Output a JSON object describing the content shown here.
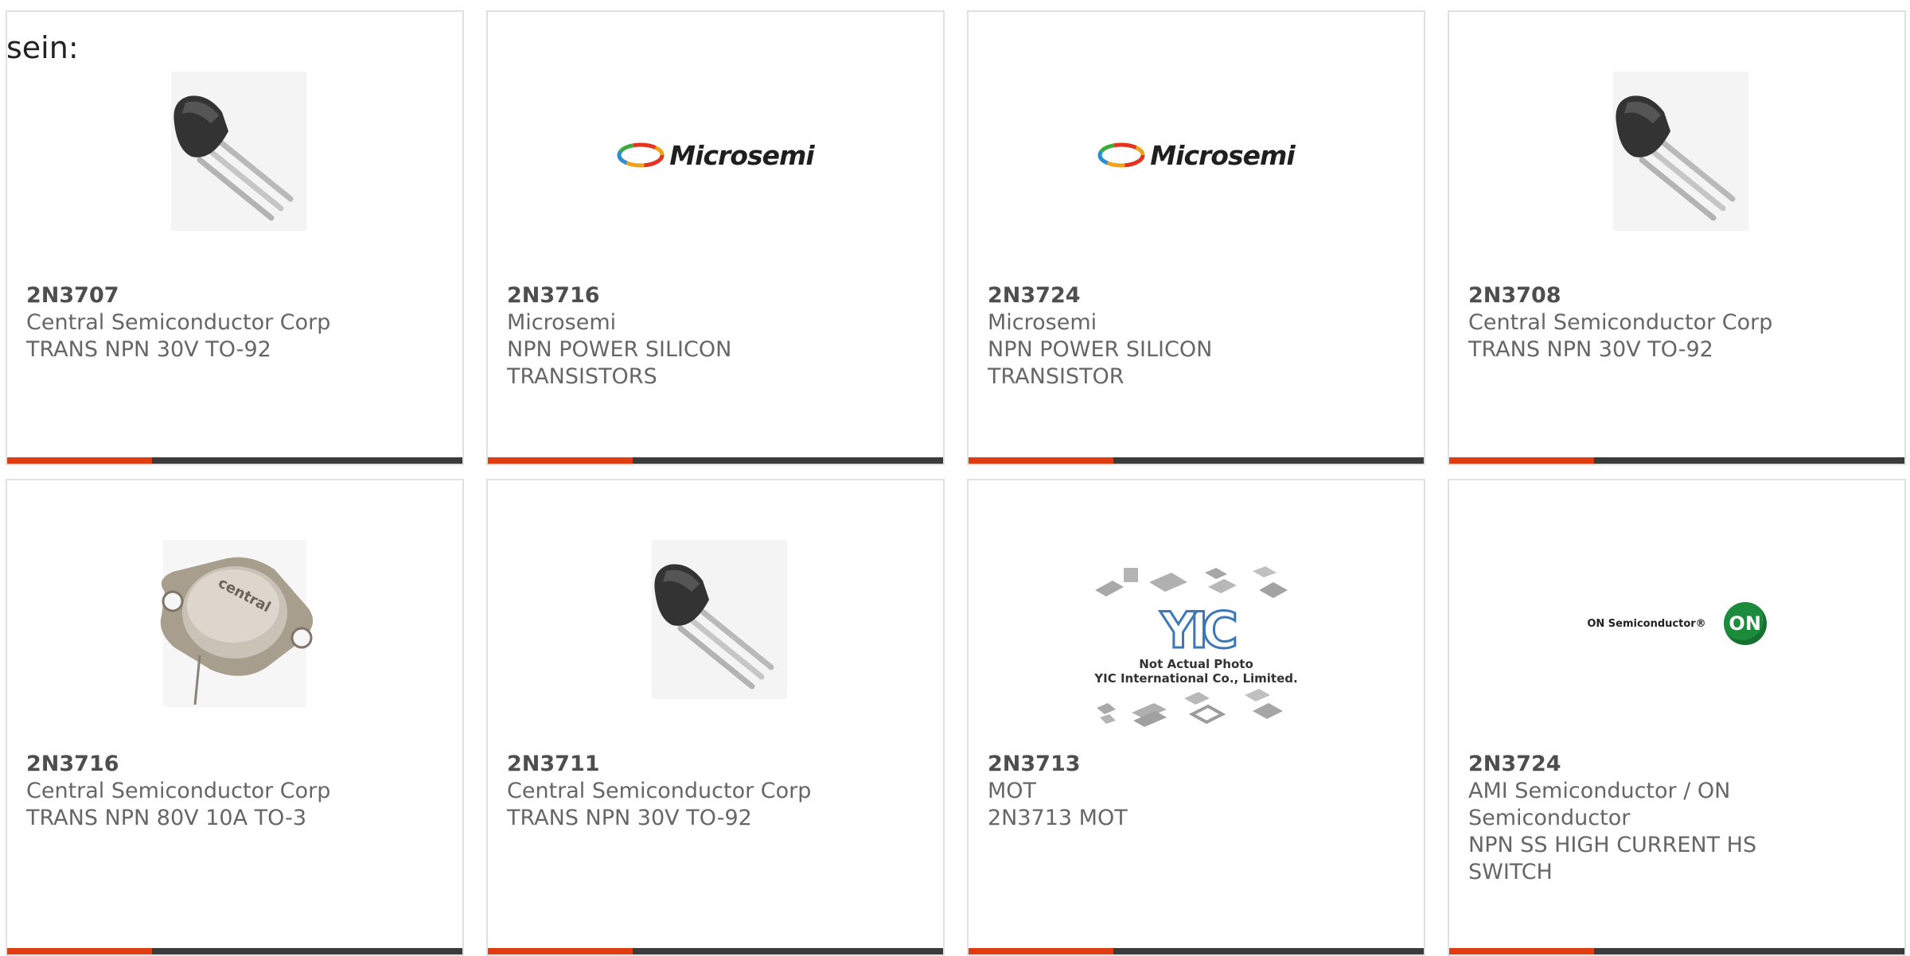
{
  "intro_text": "sein:",
  "colors": {
    "accent": "#e03c12",
    "bar": "#3b3b3b",
    "border": "#e1e1e1"
  },
  "products": [
    {
      "part": "2N3707",
      "manufacturer": "Central Semiconductor Corp",
      "desc_lines": [
        "TRANS NPN 30V TO-92"
      ],
      "image": "to92-transistor"
    },
    {
      "part": "2N3716",
      "manufacturer": "Microsemi",
      "desc_lines": [
        "NPN POWER SILICON",
        "TRANSISTORS"
      ],
      "image": "microsemi-logo",
      "logo_text": "Microsemi"
    },
    {
      "part": "2N3724",
      "manufacturer": "Microsemi",
      "desc_lines": [
        "NPN POWER SILICON",
        "TRANSISTOR"
      ],
      "image": "microsemi-logo",
      "logo_text": "Microsemi"
    },
    {
      "part": "2N3708",
      "manufacturer": "Central Semiconductor Corp",
      "desc_lines": [
        "TRANS NPN 30V TO-92"
      ],
      "image": "to92-transistor"
    },
    {
      "part": "2N3716",
      "manufacturer": "Central Semiconductor Corp",
      "desc_lines": [
        "TRANS NPN 80V 10A TO-3"
      ],
      "image": "to3-transistor",
      "logo_text": "central"
    },
    {
      "part": "2N3711",
      "manufacturer": "Central Semiconductor Corp",
      "desc_lines": [
        "TRANS NPN 30V TO-92"
      ],
      "image": "to92-transistor"
    },
    {
      "part": "2N3713",
      "manufacturer": "MOT",
      "desc_lines": [
        "2N3713 MOT"
      ],
      "image": "yic-placeholder",
      "logo_text": "YIC",
      "photo_note_1": "Not Actual Photo",
      "photo_note_2": "YIC International Co., Limited."
    },
    {
      "part": "2N3724",
      "manufacturer_lines": [
        "AMI Semiconductor / ON",
        "Semiconductor"
      ],
      "desc_lines": [
        "NPN SS HIGH CURRENT HS",
        "SWITCH"
      ],
      "image": "on-semi-logo",
      "logo_text": "ON Semiconductor®",
      "logo_badge": "ON"
    }
  ]
}
